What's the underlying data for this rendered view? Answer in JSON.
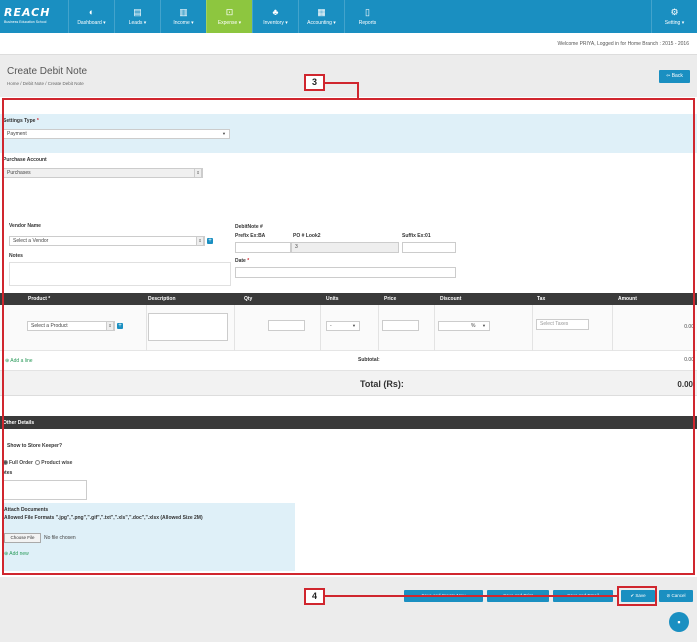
{
  "app": {
    "logo_text": "REACH",
    "logo_sub": "Business Education School"
  },
  "nav": {
    "items": [
      {
        "label": "Dashboard ▾",
        "icon": "◐"
      },
      {
        "label": "Leads ▾",
        "icon": "▤"
      },
      {
        "label": "Income ▾",
        "icon": "▥"
      },
      {
        "label": "Expense ▾",
        "icon": "⊡"
      },
      {
        "label": "Inventory ▾",
        "icon": "♣"
      },
      {
        "label": "Accounting ▾",
        "icon": "▦"
      },
      {
        "label": "Reports",
        "icon": "▯"
      }
    ],
    "setting_label": "Setting ▾",
    "setting_icon": "⚙",
    "active_index": 3,
    "active_color": "#8dc63f",
    "bar_color": "#1a8fc1"
  },
  "welcome_text": "Welcome PRIYA, Logged in for Home Branch : 2015 - 2016",
  "header": {
    "title": "Create Debit Note",
    "breadcrumb": "Home / Debit Note / Create Debit Note",
    "back_label": "⇦ Back"
  },
  "callouts": {
    "form": "3",
    "save": "4"
  },
  "form": {
    "settings_type_label": "Settings Type",
    "settings_type_required": "*",
    "settings_type_value": "Payment",
    "purchase_account_label": "Purchase Account",
    "purchase_account_value": "Purchases",
    "vendor_label": "Vendor Name",
    "vendor_placeholder": "Select a Vendor",
    "notes_label": "Notes",
    "debitnote_label": "DebitNote #",
    "prefix_label": "Prefix Ex:BA",
    "po_label": "PO # Look2",
    "po_value": "3",
    "suffix_label": "Suffix Ex:01",
    "date_label": "Date",
    "date_required": "*"
  },
  "table": {
    "headers": [
      "Product",
      "Description",
      "Qty",
      "Units",
      "Price",
      "Discount",
      "Tax",
      "Amount"
    ],
    "product_required": "*",
    "product_placeholder": "Select a Product",
    "units_value": "-",
    "discount_unit": "%",
    "tax_placeholder": "Select Taxes",
    "row_amount": "0.00",
    "add_line": "⊕ Add a line",
    "subtotal_label": "Subtotal:",
    "subtotal_value": "0.00",
    "total_label": "Total (Rs):",
    "total_value": "0.00"
  },
  "other": {
    "header": "Other Details",
    "show_store_keeper": "Show to Store Keeper?",
    "order_full": "Full Order",
    "order_product": "Product wise",
    "notes_label": "otes",
    "attach_title": "Attach Documents",
    "attach_formats": "Allowed File Formats \".jpg\",\".png\",\".gif\",\".txt\",\".xls\",\".doc\",\".xlsx (Allowed Size 2M)",
    "choose_file": "Choose File",
    "no_file": "No file chosen",
    "add_new": "⊕ Add new"
  },
  "actions": {
    "btn1": "Save and Create New",
    "btn2": "Save and Print",
    "btn3": "Save and Email",
    "save": "✔ Save",
    "cancel": "⊘ Cancel"
  },
  "colors": {
    "highlight": "#d0262e",
    "accent": "#1a8fc1"
  }
}
